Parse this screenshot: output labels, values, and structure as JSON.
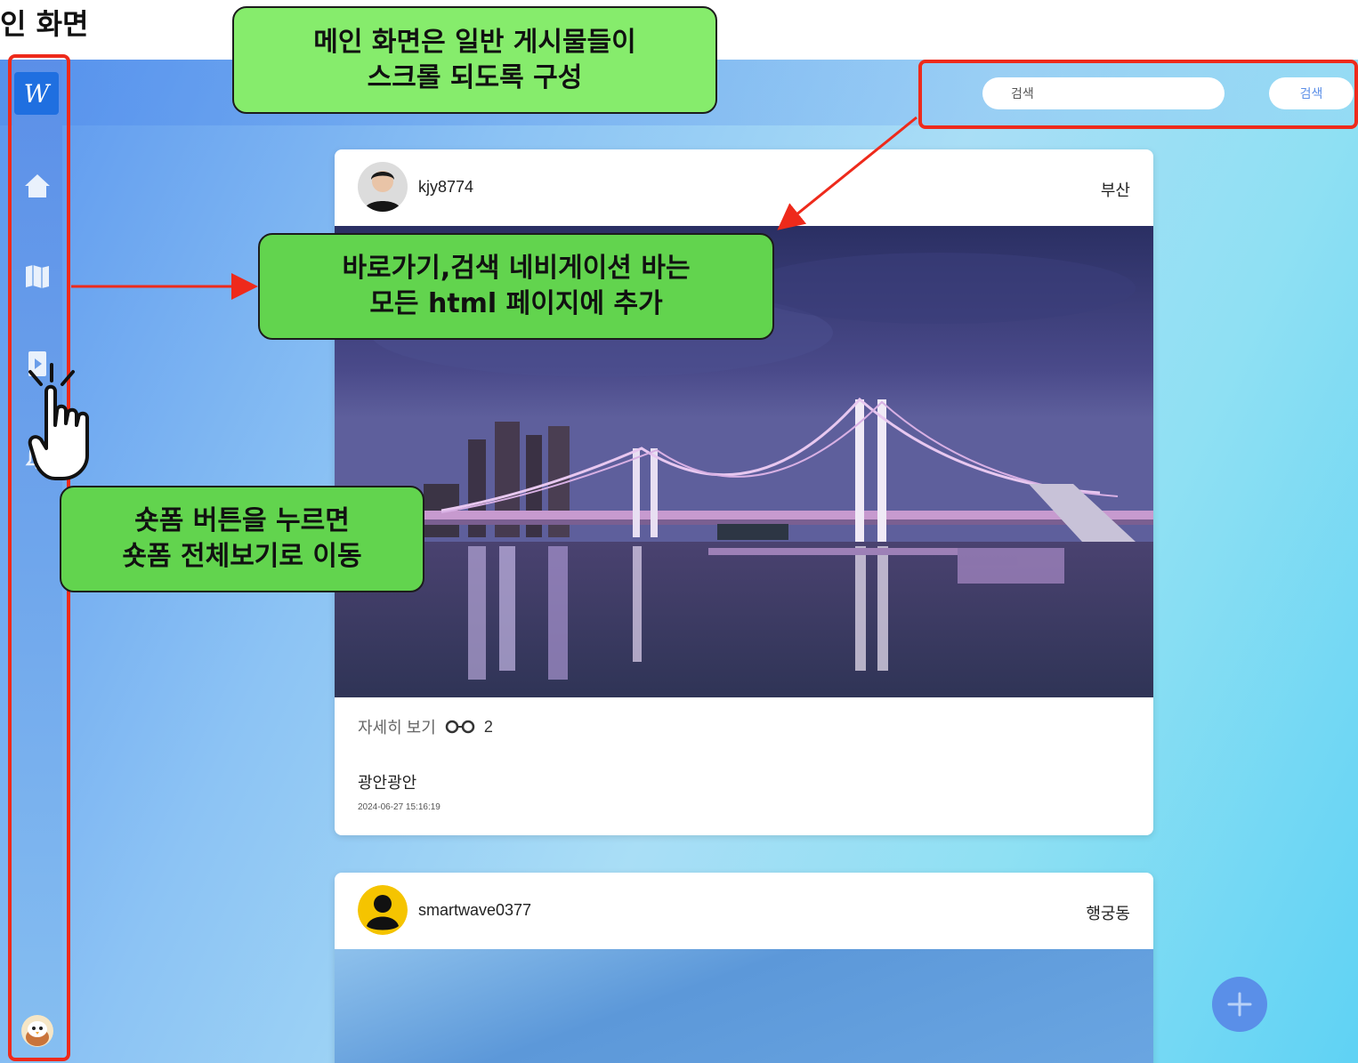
{
  "slide": {
    "title": "인 화면"
  },
  "sidebar": {
    "logo": "W",
    "icons": [
      "home-icon",
      "map-icon",
      "shortform-icon",
      "bell-icon",
      "profile-icon"
    ]
  },
  "search": {
    "placeholder": "검색",
    "button_label": "검색"
  },
  "posts": [
    {
      "username": "kjy8774",
      "location": "부산",
      "detail_label": "자세히 보기",
      "views": "2",
      "caption": "광안광안",
      "date": "2024-06-27 15:16:19"
    },
    {
      "username": "smartwave0377",
      "location": "행궁동"
    }
  ],
  "annotations": {
    "scroll_note": [
      "메인 화면은 일반 게시물들이",
      "스크롤 되도록 구성"
    ],
    "nav_note": [
      "바로가기,검색 네비게이션 바는",
      "모든 html 페이지에 추가"
    ],
    "shortform_note": [
      "숏폼 버튼을 누르면",
      "숏폼 전체보기로 이동"
    ]
  },
  "colors": {
    "annotation_green": "#62d44e",
    "annotation_red": "#ee2a1b",
    "sidebar_blue": "#5b8fe8",
    "logo_blue": "#1f6fe0"
  }
}
